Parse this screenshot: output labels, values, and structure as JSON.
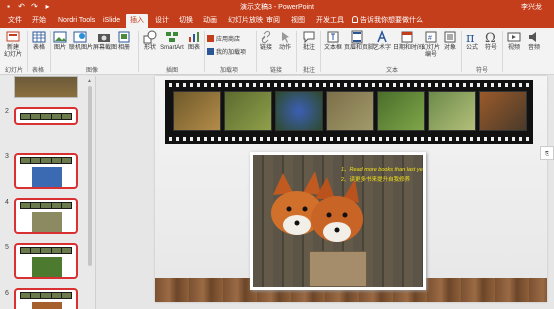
{
  "titlebar": {
    "title": "演示文稿3 - PowerPoint",
    "user": "李兴龙",
    "qat": [
      "save",
      "undo",
      "redo",
      "start-from-beginning"
    ]
  },
  "tabs": [
    {
      "label": "文件",
      "active": false
    },
    {
      "label": "开始",
      "active": false
    },
    {
      "label": "Nordri Tools",
      "active": false
    },
    {
      "label": "iSlide",
      "active": false
    },
    {
      "label": "插入",
      "active": true
    },
    {
      "label": "设计",
      "active": false
    },
    {
      "label": "切换",
      "active": false
    },
    {
      "label": "动画",
      "active": false
    },
    {
      "label": "幻灯片放映",
      "active": false
    },
    {
      "label": "审阅",
      "active": false
    },
    {
      "label": "视图",
      "active": false
    },
    {
      "label": "开发工具",
      "active": false
    }
  ],
  "tellme": "告诉我你想要做什么",
  "ribbon": {
    "new_slide": "新建\n幻灯片",
    "table": "表格",
    "picture": "图片",
    "online_picture": "联机图片",
    "screenshot": "屏幕截图",
    "album": "相册",
    "shapes": "形状",
    "smartart": "SmartArt",
    "chart": "图表",
    "store": "应用商店",
    "my_addins": "我的加载项",
    "link": "链接",
    "action": "动作",
    "comment": "批注",
    "textbox": "文本框",
    "header_footer": "页眉和页脚",
    "wordart": "艺术字",
    "datetime": "日期和时间",
    "slide_number": "幻灯片\n编号",
    "object": "对象",
    "equation": "公式",
    "symbol": "符号",
    "video": "视频",
    "audio": "音频",
    "groups": {
      "slides": "幻灯片",
      "tables": "表格",
      "images": "图像",
      "illustrations": "插图",
      "addins": "加载项",
      "links": "链接",
      "comments": "批注",
      "text": "文本",
      "symbols": "符号"
    }
  },
  "slides_panel": {
    "numbers": [
      "2",
      "3",
      "4",
      "5",
      "6"
    ]
  },
  "slide": {
    "caption_line1": "1、Read more books than last year",
    "caption_line2": "2、读更多书来提升自我修养"
  },
  "colors": {
    "accent": "#c43e1c",
    "ribbon_bg": "#f3f3f3",
    "thumb_border": "#d93131",
    "caption": "#f2e01a"
  }
}
